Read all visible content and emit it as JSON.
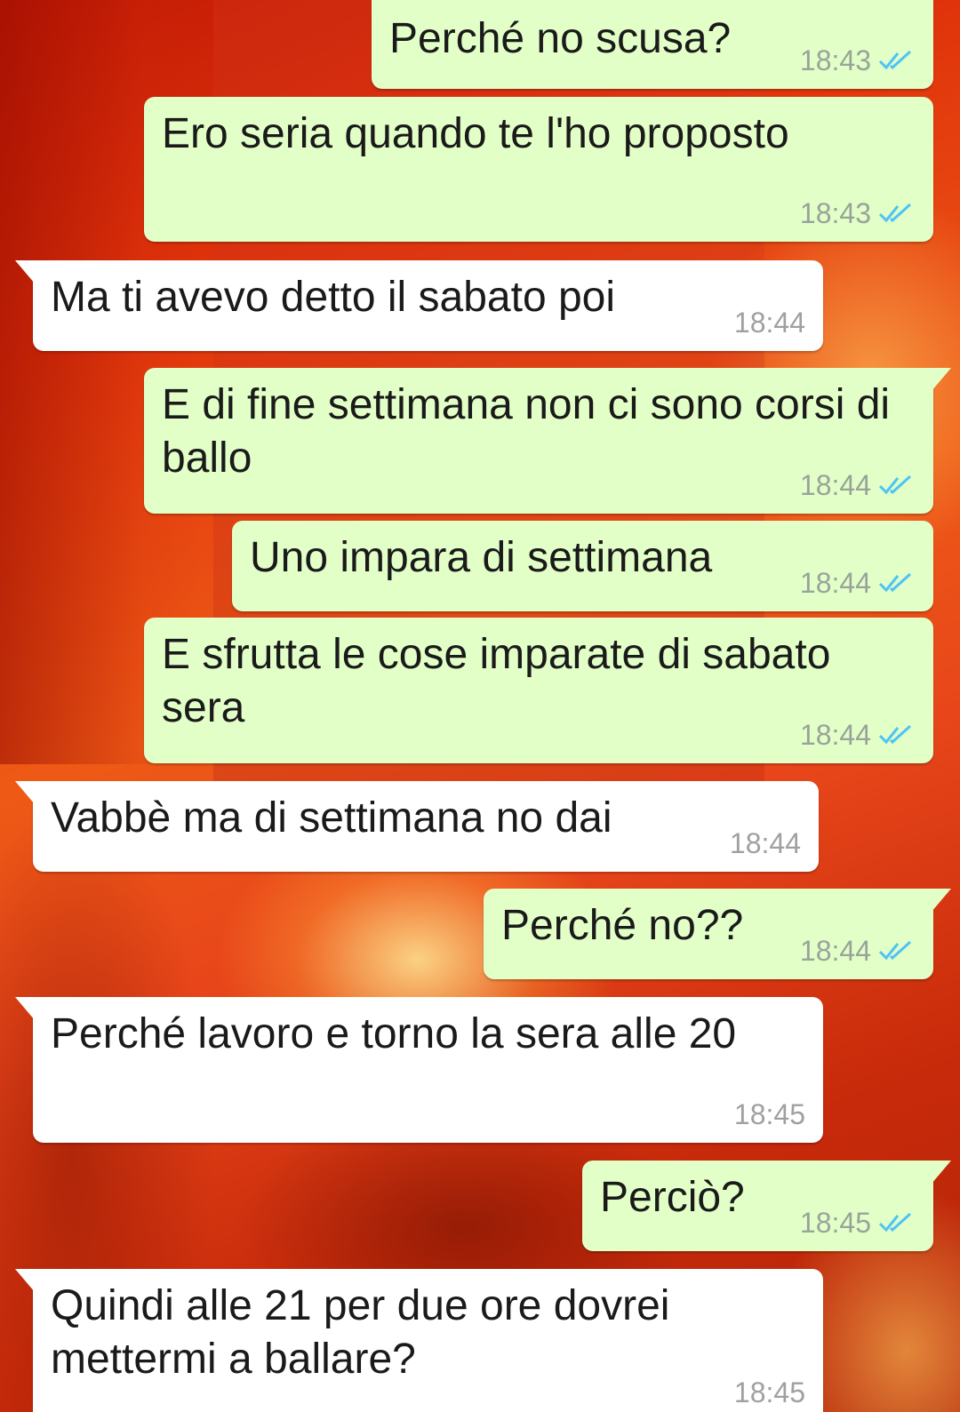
{
  "colors": {
    "outgoing_bubble": "#e2ffc7",
    "incoming_bubble": "#ffffff",
    "read_ticks": "#4fc3f7"
  },
  "messages": [
    {
      "dir": "out",
      "text": "Perché no scusa?",
      "time": "18:43",
      "status": "read"
    },
    {
      "dir": "out",
      "text": "Ero seria quando te l'ho proposto",
      "time": "18:43",
      "status": "read"
    },
    {
      "dir": "in",
      "text": "Ma ti avevo detto il sabato poi",
      "time": "18:44"
    },
    {
      "dir": "out",
      "text": "E di fine settimana non ci sono corsi di ballo",
      "time": "18:44",
      "status": "read"
    },
    {
      "dir": "out",
      "text": "Uno impara di settimana",
      "time": "18:44",
      "status": "read"
    },
    {
      "dir": "out",
      "text": "E sfrutta le cose imparate di sabato sera",
      "time": "18:44",
      "status": "read"
    },
    {
      "dir": "in",
      "text": "Vabbè ma di settimana no dai",
      "time": "18:44"
    },
    {
      "dir": "out",
      "text": "Perché no??",
      "time": "18:44",
      "status": "read"
    },
    {
      "dir": "in",
      "text": "Perché lavoro e torno la sera alle 20",
      "time": "18:45"
    },
    {
      "dir": "out",
      "text": "Perciò?",
      "time": "18:45",
      "status": "read"
    },
    {
      "dir": "in",
      "text": "Quindi alle 21 per due ore dovrei mettermi a ballare?",
      "time": "18:45"
    }
  ]
}
